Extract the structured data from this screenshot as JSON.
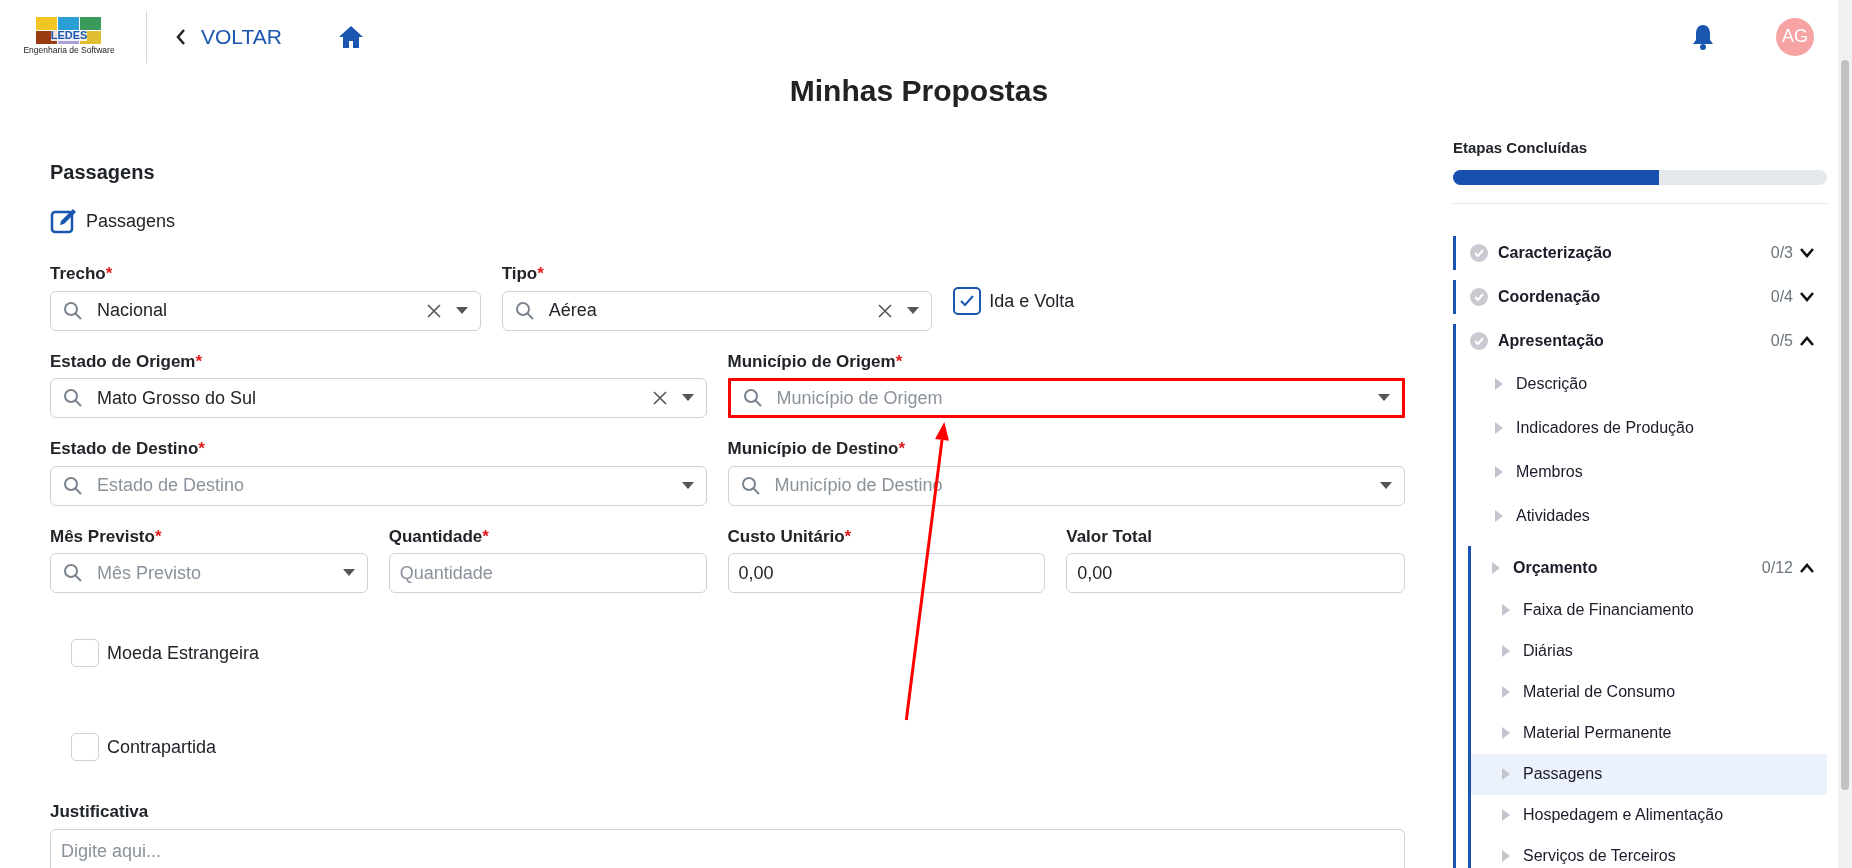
{
  "header": {
    "logo": {
      "title": "LEDES",
      "subtitle": "Engenharia de Software"
    },
    "back_link": "VOLTAR",
    "avatar": "AG"
  },
  "page_title": "Minhas Propostas",
  "form": {
    "section_title": "Passagens",
    "subtitle": "Passagens",
    "rows": [
      {
        "fields": [
          {
            "kind": "select",
            "label": "Trecho",
            "required_mark": "*",
            "value": "Nacional",
            "clearable": true
          },
          {
            "kind": "select",
            "label": "Tipo",
            "required_mark": "*",
            "value": "Aérea",
            "clearable": true
          },
          {
            "kind": "checkbox",
            "label": "Ida e Volta",
            "checked": true
          }
        ]
      },
      {
        "fields": [
          {
            "kind": "select",
            "label": "Estado de Origem",
            "required_mark": "*",
            "value": "Mato Grosso do Sul",
            "clearable": true
          },
          {
            "kind": "select",
            "label": "Município de Origem",
            "required_mark": "*",
            "placeholder": "Município de Origem",
            "annotated": true
          }
        ]
      },
      {
        "fields": [
          {
            "kind": "select",
            "label": "Estado de Destino",
            "required_mark": "*",
            "placeholder": "Estado de Destino"
          },
          {
            "kind": "select",
            "label": "Município de Destino",
            "required_mark": "*",
            "placeholder": "Município de Destino"
          }
        ]
      },
      {
        "fields": [
          {
            "kind": "select",
            "label": "Mês Previsto",
            "required_mark": "*",
            "placeholder": "Mês Previsto"
          },
          {
            "kind": "text",
            "label": "Quantidade",
            "required_mark": "*",
            "placeholder": "Quantidade"
          },
          {
            "kind": "text",
            "label": "Custo Unitário",
            "required_mark": "*",
            "value": "0,00"
          },
          {
            "kind": "text",
            "label": "Valor Total",
            "value": "0,00"
          }
        ]
      },
      {
        "fields": [
          {
            "kind": "checkbox",
            "label": "Moeda Estrangeira",
            "checked": false
          }
        ]
      },
      {
        "fields": [
          {
            "kind": "checkbox",
            "label": "Contrapartida",
            "checked": false
          }
        ]
      },
      {
        "fields": [
          {
            "kind": "textarea",
            "label": "Justificativa",
            "placeholder": "Digite aqui..."
          }
        ]
      }
    ]
  },
  "sidebar": {
    "progress": {
      "title": "Etapas Concluídas",
      "level": 0.55
    },
    "sections": [
      {
        "label": "Caracterização",
        "count": "0/3",
        "completed": false,
        "expanded": false
      },
      {
        "label": "Coordenação",
        "count": "0/4",
        "completed": false,
        "expanded": false
      },
      {
        "label": "Apresentação",
        "count": "0/5",
        "completed": false,
        "expanded": true,
        "children": [
          {
            "label": "Descrição",
            "selected": false
          },
          {
            "label": "Indicadores de Produção",
            "selected": false
          },
          {
            "label": "Membros",
            "selected": false
          },
          {
            "label": "Atividades",
            "selected": false
          },
          {
            "label": "Orçamento",
            "count": "0/12",
            "expanded": true,
            "selected": false,
            "children": [
              {
                "label": "Faixa de Financiamento",
                "selected": false
              },
              {
                "label": "Diárias",
                "selected": false
              },
              {
                "label": "Material de Consumo",
                "selected": false
              },
              {
                "label": "Material Permanente",
                "selected": false
              },
              {
                "label": "Passagens",
                "selected": true
              },
              {
                "label": "Hospedagem e Alimentação",
                "selected": false
              },
              {
                "label": "Serviços de Terceiros",
                "selected": false
              }
            ]
          }
        ]
      }
    ]
  }
}
